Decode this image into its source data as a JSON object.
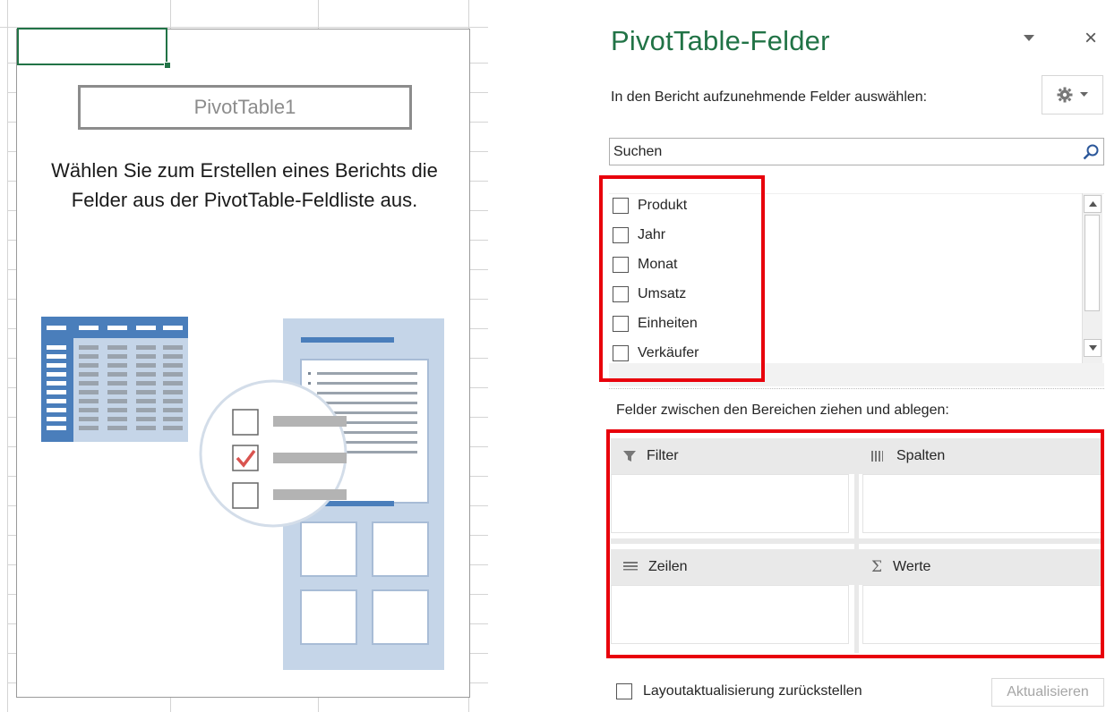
{
  "sheet": {
    "pivot_name": "PivotTable1",
    "instructions": "Wählen Sie zum Erstellen eines Berichts die Felder aus der PivotTable-Feldliste aus.",
    "illustration_icon": "pivot-table-illustration"
  },
  "pane": {
    "title": "PivotTable-Felder",
    "dropdown_icon": "chevron-down-icon",
    "close_label": "×",
    "choose_fields_label": "In den Bericht aufzunehmende Felder auswählen:",
    "gear_icon": "gear-icon",
    "search": {
      "placeholder": "Suchen",
      "value": ""
    },
    "fields": [
      {
        "label": "Produkt",
        "checked": false
      },
      {
        "label": "Jahr",
        "checked": false
      },
      {
        "label": "Monat",
        "checked": false
      },
      {
        "label": "Umsatz",
        "checked": false
      },
      {
        "label": "Einheiten",
        "checked": false
      },
      {
        "label": "Verkäufer",
        "checked": false
      }
    ],
    "drag_label": "Felder zwischen den Bereichen ziehen und ablegen:",
    "areas": {
      "filter": {
        "label": "Filter",
        "icon": "filter-icon"
      },
      "columns": {
        "label": "Spalten",
        "icon": "columns-icon"
      },
      "rows": {
        "label": "Zeilen",
        "icon": "rows-icon"
      },
      "values": {
        "label": "Werte",
        "icon": "sigma-icon"
      }
    },
    "defer_label": "Layoutaktualisierung zurückstellen",
    "defer_checked": false,
    "update_button": "Aktualisieren"
  },
  "colors": {
    "accent_green": "#217346",
    "highlight_red": "#e8000b",
    "illustration_blue": "#4a7ebb",
    "illustration_light_blue": "#c5d5e8",
    "check_red": "#d9534f"
  }
}
